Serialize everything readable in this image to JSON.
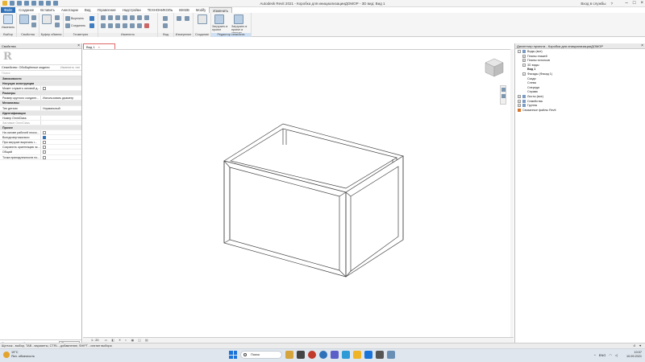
{
  "window": {
    "title": "Autodesk Revit 2021 - Коробка для инициализацииДОМОР - 3D вид: Вид 1",
    "signin": "Вход в службы",
    "help": "?"
  },
  "menu_tabs": [
    "Файл",
    "Создание",
    "Вставить",
    "Аннотации",
    "Вид",
    "Управление",
    "Надстройки",
    "ТЕХНОНИКОЛЬ",
    "BIM2B",
    "Modify",
    "Изменить"
  ],
  "ribbon": {
    "modify_label": "Изменить",
    "cut_label": "Вырезать",
    "join_label": "Соединить",
    "groups": [
      "Выбор",
      "Свойства",
      "Буфер обмена",
      "Геометрия",
      "Изменить",
      "Вид",
      "Измерение",
      "Создание",
      "Редактор семейств"
    ],
    "load_project": "Загрузить в проект",
    "load_project_close": "Загрузить в проект и закрыть"
  },
  "properties": {
    "title": "Свойства",
    "family": "Семейство: Обобщённые модели",
    "edit_type": "Изменить тип",
    "search_placeholder": "Поиск",
    "groups": [
      {
        "name": "Зависимости",
        "rows": []
      },
      {
        "name": "Несущие конструкции",
        "rows": [
          {
            "k": "Может служить основой д...",
            "v": "",
            "cb": "off"
          }
        ]
      },
      {
        "name": "Размеры",
        "rows": [
          {
            "k": "Размер круглого соедине...",
            "v": "Использовать диаметр"
          }
        ]
      },
      {
        "name": "Механизмы",
        "rows": [
          {
            "k": "Тип детали",
            "v": "Нормальный"
          }
        ]
      },
      {
        "name": "Идентификация",
        "rows": [
          {
            "k": "Номер OmniClass",
            "v": ""
          },
          {
            "k": "Заглавие OmniClass",
            "v": "",
            "grey": true
          }
        ]
      },
      {
        "name": "Прочее",
        "rows": [
          {
            "k": "На основе рабочей плоск...",
            "v": "",
            "cb": "off"
          },
          {
            "k": "Всегда вертикально",
            "v": "",
            "cb": "on"
          },
          {
            "k": "При загрузке вырезать г...",
            "v": "",
            "cb": "off"
          },
          {
            "k": "Сохранить ориентацию эк...",
            "v": "",
            "cb": "off"
          },
          {
            "k": "Общий",
            "v": "",
            "cb": "off"
          },
          {
            "k": "Точка принадлежности по...",
            "v": "",
            "cb": "off"
          }
        ]
      }
    ],
    "help_link": "Справка по свойствам",
    "apply": "Применить"
  },
  "view": {
    "tab_label": "Вид 1",
    "scale": "1 : 20"
  },
  "browser": {
    "title": "Диспетчер проекта - Коробка для инициализацииДОМОР",
    "items": [
      {
        "label": "Виды (все)",
        "level": 0,
        "exp": "−",
        "ico": "view"
      },
      {
        "label": "Планы этажей",
        "level": 1,
        "exp": "+"
      },
      {
        "label": "Планы потолков",
        "level": 1,
        "exp": "+"
      },
      {
        "label": "3D виды",
        "level": 1,
        "exp": "−"
      },
      {
        "label": "Вид 1",
        "level": 2,
        "bold": true
      },
      {
        "label": "Фасады (Фасад 1)",
        "level": 1,
        "exp": "−"
      },
      {
        "label": "Сзади",
        "level": 2
      },
      {
        "label": "Слева",
        "level": 2
      },
      {
        "label": "Спереди",
        "level": 2
      },
      {
        "label": "Справа",
        "level": 2
      },
      {
        "label": "Листы (все)",
        "level": 0,
        "exp": "+",
        "ico": "sheet"
      },
      {
        "label": "Семейства",
        "level": 0,
        "exp": "+",
        "ico": "fam"
      },
      {
        "label": "Группы",
        "level": 0,
        "exp": "+",
        "ico": "grp"
      },
      {
        "label": "Связанные файлы Revit",
        "level": 0,
        "ico": "link"
      }
    ]
  },
  "statusbar": {
    "text": "Щелчок - выбор, TAB - варианты, CTRL - добавление, SHIFT - снятие выбора",
    "zero": ":0"
  },
  "taskbar": {
    "temp": "19°C",
    "weather": "Ясн. облачность",
    "search": "Поиск",
    "lang": "ENG",
    "time": "10:07",
    "date": "10.09.2021"
  },
  "colors": {
    "accent": "#2f71b8",
    "view_tab_border": "#e06666",
    "link_icon": "#d7742a"
  }
}
